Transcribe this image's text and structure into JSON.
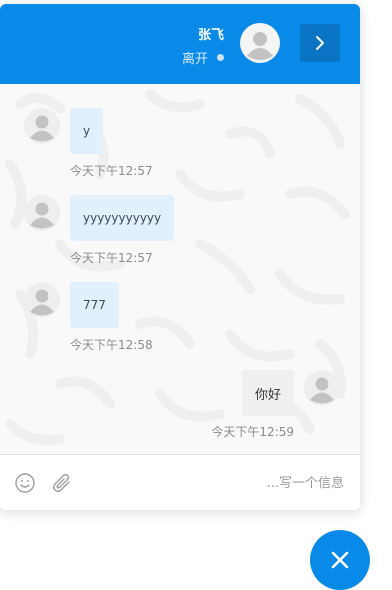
{
  "header": {
    "agent_name": "张飞",
    "status": "离开",
    "avatar_icon": "user-avatar-icon",
    "expand_icon": "chevron-right-icon"
  },
  "messages": [
    {
      "direction": "incoming",
      "text": "y",
      "time": "今天下午12:57"
    },
    {
      "direction": "incoming",
      "text": "yyyyyyyyyyy",
      "time": "今天下午12:57"
    },
    {
      "direction": "incoming",
      "text": "777",
      "time": "今天下午12:58"
    },
    {
      "direction": "outgoing",
      "text": "你好",
      "time": "今天下午12:59"
    }
  ],
  "composer": {
    "placeholder": "...写一个信息",
    "emoji_icon": "smiley-icon",
    "attach_icon": "paperclip-icon"
  },
  "fab": {
    "icon": "close-icon"
  },
  "colors": {
    "brand": "#0a8ae8",
    "brand_dark": "#0a74c4",
    "incoming_bubble": "#e1f0fc",
    "outgoing_bubble": "#efefef"
  }
}
